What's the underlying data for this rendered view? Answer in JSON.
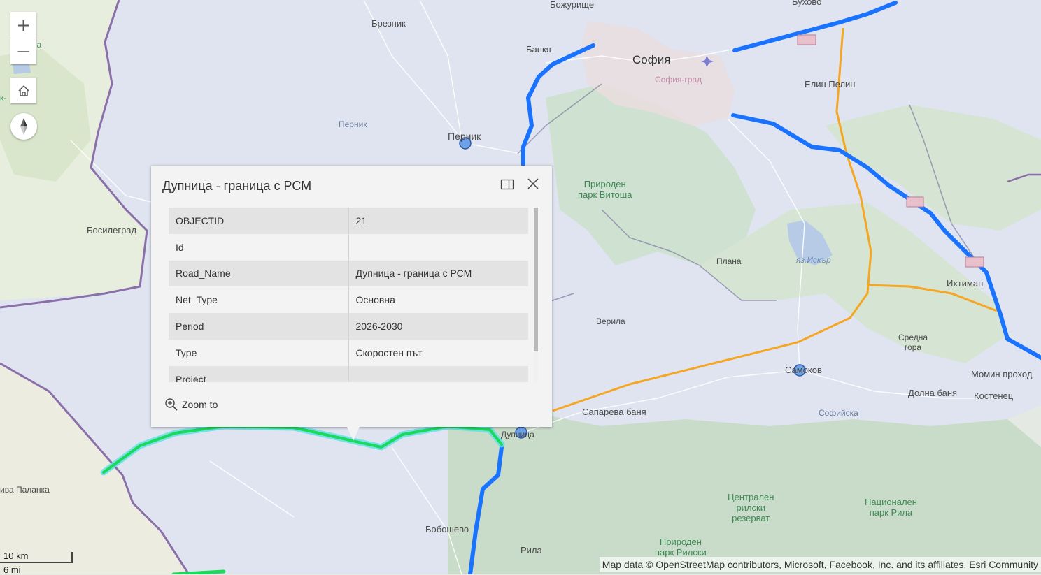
{
  "map": {
    "places": {
      "bozhurishte": "Божурище",
      "buhovo": "Бухово",
      "breznik": "Брезник",
      "bankya": "Банкя",
      "sofia": "София",
      "sofia_grad": "София-град",
      "elin_pelin": "Елин Пелин",
      "pernik_town": "Перник",
      "pernik_region": "Перник",
      "bosilegrad": "Босилеград",
      "vitosha": "Природен\nпарк Витоша",
      "iskar_lake": "яз.Искър",
      "plana": "Плана",
      "ihtiman": "Ихтиман",
      "verila": "Верила",
      "sredna_gora": "Средна\nгора",
      "samokov": "Самоков",
      "momin_prohod": "Момин проход",
      "dolna_banya": "Долна баня",
      "kostenets": "Костенец",
      "saparevа_banya": "Сапарева баня",
      "sofiyska": "Софийска",
      "dupnitsa": "Дупница",
      "kriva_palanka": "ива Паланка",
      "boboshevo": "Бобошево",
      "rila_town": "Рила",
      "central_rila": "Централен\nрилски\nрезерват",
      "national_park_rila": "Национален\nпарк Рила",
      "rila_monastery": "Природен\nпарк Рилски",
      "edge_na": "на",
      "edge_k": "к-"
    },
    "colors": {
      "planned_road": "#1a73ff",
      "selected_road": "#1bd95a",
      "ring_road": "#f5a623",
      "border": "#8a6fa8"
    }
  },
  "controls": {
    "zoom_in": "+",
    "zoom_out": "—"
  },
  "popup": {
    "title": "Дупница - граница с РСМ",
    "fields": [
      {
        "key": "OBJECTID",
        "value": "21"
      },
      {
        "key": "Id",
        "value": ""
      },
      {
        "key": "Road_Name",
        "value": "Дупница - граница с РСМ"
      },
      {
        "key": "Net_Type",
        "value": "Основна"
      },
      {
        "key": "Period",
        "value": "2026-2030"
      },
      {
        "key": "Type",
        "value": "Скоростен път"
      },
      {
        "key": "Project",
        "value": ""
      }
    ],
    "zoom_label": "Zoom to"
  },
  "scale": {
    "km": "10 km",
    "mi": "6 mi"
  },
  "attribution": "Map data © OpenStreetMap contributors, Microsoft, Facebook, Inc. and its affiliates, Esri Community"
}
